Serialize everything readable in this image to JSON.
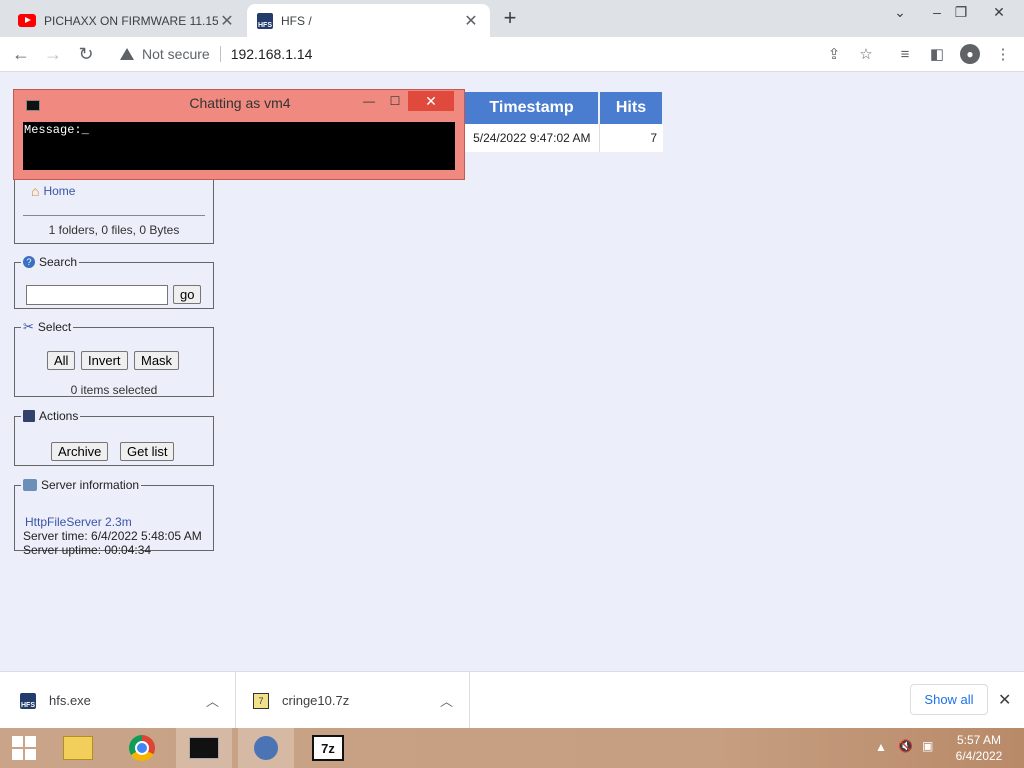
{
  "browser": {
    "tabs": [
      {
        "title": "PICHAXX ON FIRMWARE 11.15 -",
        "icon": "youtube-icon",
        "active": false
      },
      {
        "title": "HFS /",
        "icon": "hfs-icon",
        "active": true
      }
    ],
    "address": {
      "security_label": "Not secure",
      "url": "192.168.1.14"
    }
  },
  "chat": {
    "title": "Chatting as vm4",
    "prompt": "Message:_"
  },
  "sidebar": {
    "home_label": "Home",
    "stats": "1 folders, 0 files, 0 Bytes",
    "search": {
      "legend": "Search",
      "value": "",
      "go_label": "go"
    },
    "select": {
      "legend": "Select",
      "all_label": "All",
      "invert_label": "Invert",
      "mask_label": "Mask",
      "status": "0 items selected"
    },
    "actions": {
      "legend": "Actions",
      "archive_label": "Archive",
      "getlist_label": "Get list"
    },
    "server": {
      "legend": "Server information",
      "version": "HttpFileServer 2.3m",
      "time": "Server time: 6/4/2022 5:48:05 AM",
      "uptime": "Server uptime: 00:04:34"
    }
  },
  "file_table": {
    "headers": [
      "Timestamp",
      "Hits"
    ],
    "rows": [
      {
        "timestamp": "5/24/2022 9:47:02 AM",
        "hits": "7"
      }
    ]
  },
  "downloads": {
    "items": [
      {
        "name": "hfs.exe"
      },
      {
        "name": "cringe10.7z"
      }
    ],
    "show_all_label": "Show all"
  },
  "taskbar": {
    "time": "5:57 AM",
    "date": "6/4/2022"
  },
  "colors": {
    "table_header": "#4a7cd0",
    "chat_bg": "#f08a80",
    "page_bg": "#eceef9"
  }
}
